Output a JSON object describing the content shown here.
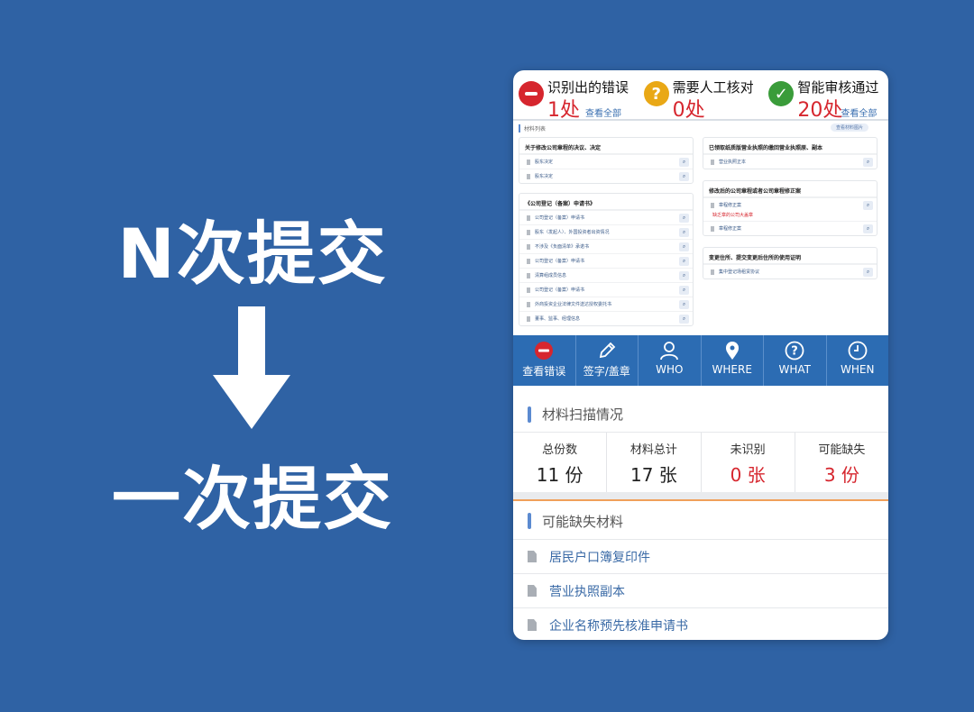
{
  "slogan": {
    "before": "N次提交",
    "after": "一次提交"
  },
  "summary": [
    {
      "title": "识别出的错误",
      "count": "1处",
      "link": "查看全部",
      "icon": "minus-circle-icon"
    },
    {
      "title": "需要人工核对",
      "count": "0处",
      "link": "",
      "icon": "question-circle-icon"
    },
    {
      "title": "智能审核通过",
      "count": "20处",
      "link": "查看全部",
      "icon": "check-circle-icon"
    }
  ],
  "material_list": {
    "label": "材料列表",
    "button": "查看材料图片",
    "left_groups": [
      {
        "title": "关于修改公司章程的决议、决定",
        "items": [
          "股东决定",
          "股东决定"
        ]
      },
      {
        "title": "《公司登记（备案）申请书》",
        "items": [
          "公司登记（备案）申请书",
          "股东（发起人）、外国投资者出资情况",
          "不涉及《负面清单》承诺书",
          "公司登记（备案）申请书",
          "清算组成员信息",
          "公司登记（备案）申请书",
          "外商投资企业法律文件送达授权委托书",
          "董事、监事、经理信息"
        ]
      }
    ],
    "right_groups": [
      {
        "title": "已领取纸质版营业执照的缴回营业执照原、副本",
        "items": [
          "营业执照正本"
        ],
        "warning": ""
      },
      {
        "title": "修改后的公司章程或者公司章程修正案",
        "items": [
          "章程修正案",
          "章程修正案"
        ],
        "warning": "缺乏章的公司大盖章"
      },
      {
        "title": "变更住所、提交变更后住所的使用证明",
        "items": [
          "集中登记场租赁协议"
        ],
        "warning": ""
      }
    ]
  },
  "toolbar": [
    {
      "label": "查看错误",
      "icon": "minus-circle-icon"
    },
    {
      "label": "签字/盖章",
      "icon": "pencil-icon"
    },
    {
      "label": "WHO",
      "icon": "person-icon"
    },
    {
      "label": "WHERE",
      "icon": "location-pin-icon"
    },
    {
      "label": "WHAT",
      "icon": "question-circle-icon"
    },
    {
      "label": "WHEN",
      "icon": "clock-icon"
    }
  ],
  "scan": {
    "title": "材料扫描情况",
    "stats": [
      {
        "label": "总份数",
        "value": "11 份"
      },
      {
        "label": "材料总计",
        "value": "17 张"
      },
      {
        "label": "未识别",
        "value": "0 张"
      },
      {
        "label": "可能缺失",
        "value": "3 份"
      }
    ]
  },
  "missing": {
    "title": "可能缺失材料",
    "items": [
      "居民户口簿复印件",
      "营业执照副本",
      "企业名称预先核准申请书"
    ]
  },
  "colors": {
    "background": "#2f62a4",
    "toolbar": "#2c6cb3",
    "error_red": "#d6262e",
    "accent_blue": "#5b8ad0"
  }
}
